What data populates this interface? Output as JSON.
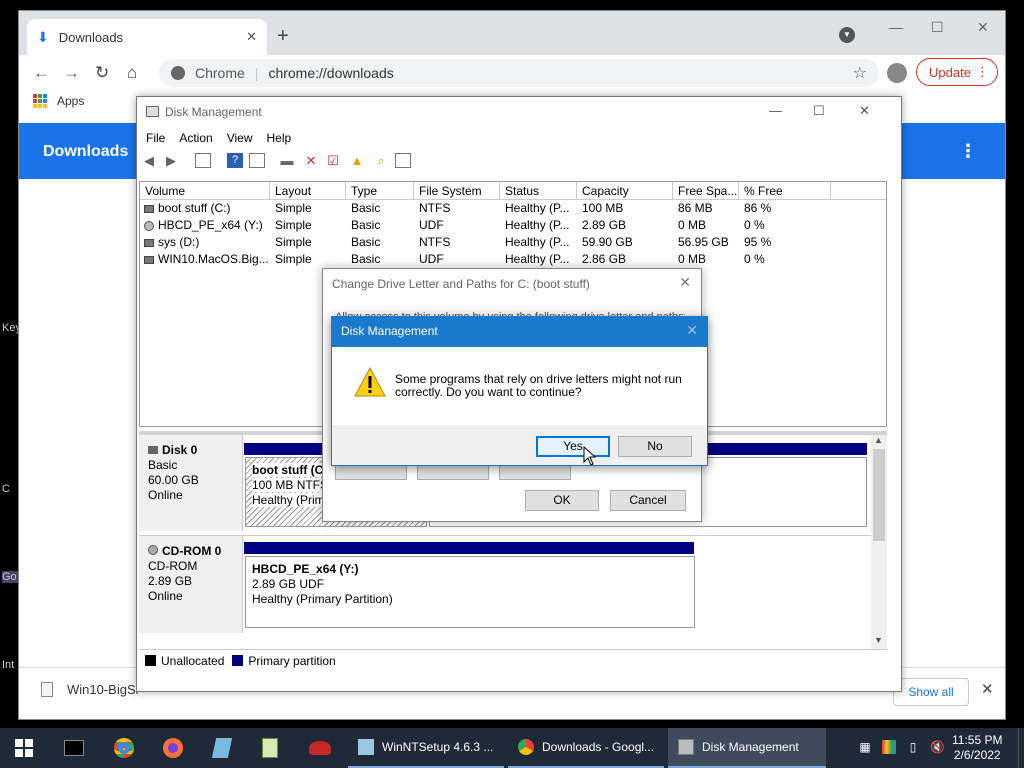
{
  "desktop": {
    "left_fragments": [
      "Key",
      "C",
      "Go",
      "Int"
    ]
  },
  "chrome": {
    "tab_title": "Downloads",
    "url_scheme_label": "Chrome",
    "url": "chrome://downloads",
    "update_label": "Update",
    "bookmark_apps": "Apps",
    "page_title": "Downloads",
    "shelf_file": "Win10-BigSi",
    "show_all": "Show all"
  },
  "disk_mgmt": {
    "title": "Disk Management",
    "menu": [
      "File",
      "Action",
      "View",
      "Help"
    ],
    "columns": [
      "Volume",
      "Layout",
      "Type",
      "File System",
      "Status",
      "Capacity",
      "Free Spa...",
      "% Free"
    ],
    "volumes": [
      {
        "icon": "drive",
        "volume": "boot stuff (C:)",
        "layout": "Simple",
        "type": "Basic",
        "fs": "NTFS",
        "status": "Healthy (P...",
        "capacity": "100 MB",
        "free": "86 MB",
        "pct": "86 %"
      },
      {
        "icon": "cd",
        "volume": "HBCD_PE_x64 (Y:)",
        "layout": "Simple",
        "type": "Basic",
        "fs": "UDF",
        "status": "Healthy (P...",
        "capacity": "2.89 GB",
        "free": "0 MB",
        "pct": "0 %"
      },
      {
        "icon": "drive",
        "volume": "sys (D:)",
        "layout": "Simple",
        "type": "Basic",
        "fs": "NTFS",
        "status": "Healthy (P...",
        "capacity": "59.90 GB",
        "free": "56.95 GB",
        "pct": "95 %"
      },
      {
        "icon": "drive",
        "volume": "WIN10.MacOS.Big...",
        "layout": "Simple",
        "type": "Basic",
        "fs": "UDF",
        "status": "Healthy (P...",
        "capacity": "2.86 GB",
        "free": "0 MB",
        "pct": "0 %"
      }
    ],
    "disk0": {
      "name": "Disk 0",
      "kind": "Basic",
      "size": "60.00 GB",
      "state": "Online",
      "part_name": "boot stuff (C",
      "part_fs": "100 MB NTFS",
      "part_status": "Healthy (Prim"
    },
    "cdrom0": {
      "name": "CD-ROM 0",
      "kind": "CD-ROM",
      "size": "2.89 GB",
      "state": "Online",
      "part_name": "HBCD_PE_x64  (Y:)",
      "part_fs": "2.89 GB UDF",
      "part_status": "Healthy (Primary Partition)"
    },
    "legend": {
      "unallocated": "Unallocated",
      "primary": "Primary partition"
    }
  },
  "change_dialog": {
    "title": "Change Drive Letter and Paths for C: (boot stuff)",
    "text": "Allow access to this volume by using the following drive letter and paths:",
    "ok": "OK",
    "cancel": "Cancel"
  },
  "confirm": {
    "title": "Disk Management",
    "message": "Some programs that rely on drive letters might not run correctly. Do you want to continue?",
    "yes": "Yes",
    "no": "No"
  },
  "taskbar": {
    "tasks": [
      "WinNTSetup 4.6.3  ...",
      "Downloads - Googl...",
      "Disk Management"
    ],
    "time": "11:55 PM",
    "date": "2/6/2022"
  },
  "colors": {
    "primary_partition": "#000080",
    "chrome_accent": "#1a73e8",
    "dialog_title": "#1979ca",
    "taskbar": "#1f2a38"
  }
}
